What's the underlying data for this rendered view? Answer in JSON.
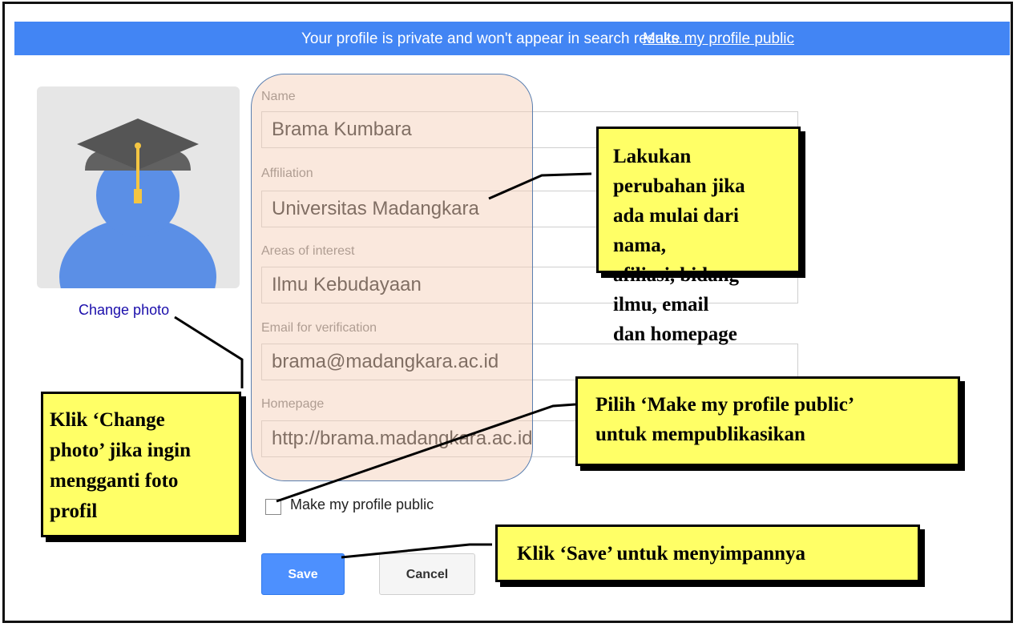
{
  "banner": {
    "message": "Your profile is private and won't appear in search results.",
    "link": "Make my profile public"
  },
  "photo": {
    "change_label": "Change photo"
  },
  "form": {
    "name": {
      "label": "Name",
      "value": "Brama Kumbara"
    },
    "affiliation": {
      "label": "Affiliation",
      "value": "Universitas Madangkara"
    },
    "interests": {
      "label": "Areas of interest",
      "value": "Ilmu Kebudayaan"
    },
    "email": {
      "label": "Email for verification",
      "value": "brama@madangkara.ac.id"
    },
    "homepage": {
      "label": "Homepage",
      "value": "http://brama.madangkara.ac.id"
    },
    "public_checkbox": {
      "label": "Make my profile public",
      "checked": false
    },
    "save_label": "Save",
    "cancel_label": "Cancel"
  },
  "callouts": {
    "edit": [
      "Lakukan perubahan jika",
      "ada mulai dari nama,",
      "afiliasi, bidang ilmu, email",
      "dan homepage"
    ],
    "public": [
      "Pilih ‘Make my profile public’",
      "untuk mempublikasikan"
    ],
    "photo": [
      "Klik ‘Change",
      "photo’ jika ingin",
      "mengganti foto",
      "profil"
    ],
    "save": [
      "Klik ‘Save’ untuk menyimpannya"
    ]
  },
  "colors": {
    "banner": "#4285f4",
    "callout": "#ffff66",
    "save_button": "#4d90fe",
    "highlight": "#f4ccb4",
    "link": "#1a0dab"
  },
  "icons": {
    "avatar": "graduate-avatar-icon"
  }
}
